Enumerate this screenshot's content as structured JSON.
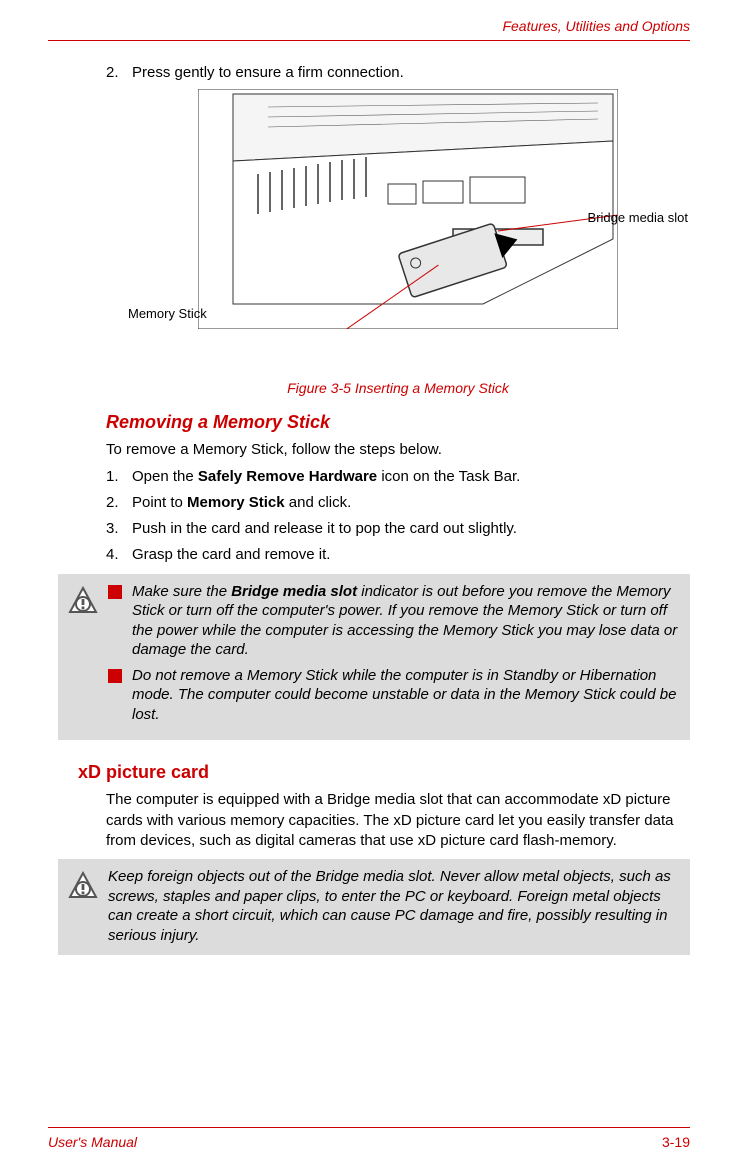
{
  "header": {
    "section_title": "Features, Utilities and Options"
  },
  "step2": {
    "num": "2.",
    "text": "Press gently to ensure a firm connection."
  },
  "figure": {
    "callout_bridge": "Bridge media slot",
    "callout_mem": "Memory Stick",
    "caption": "Figure 3-5 Inserting a Memory Stick"
  },
  "removing": {
    "title": "Removing a Memory Stick",
    "intro": "To remove a Memory Stick, follow the steps below.",
    "steps": [
      {
        "num": "1.",
        "pre": "Open the ",
        "bold": "Safely Remove Hardware",
        "post": " icon on the Task Bar."
      },
      {
        "num": "2.",
        "pre": "Point to ",
        "bold": "Memory Stick",
        "post": " and click."
      },
      {
        "num": "3.",
        "pre": "Push in the card and release it to pop the card out slightly.",
        "bold": "",
        "post": ""
      },
      {
        "num": "4.",
        "pre": "Grasp the card and remove it.",
        "bold": "",
        "post": ""
      }
    ]
  },
  "warn1": {
    "b1_pre": "Make sure the ",
    "b1_bold": "Bridge media slot",
    "b1_post": " indicator is out before you remove the Memory Stick or turn off the computer's power. If you remove the Memory Stick or turn off the power while the computer is accessing the Memory Stick you may lose data or damage the card.",
    "b2": "Do not remove a Memory Stick while the computer is in Standby or Hibernation mode. The computer could become unstable or data in the Memory Stick could be lost."
  },
  "xd": {
    "title": "xD picture card",
    "para": "The computer is equipped with a Bridge media slot that can accommodate xD picture cards with various memory capacities. The xD picture card let you easily transfer data from devices, such as digital cameras that use xD picture card flash-memory."
  },
  "warn2": {
    "text": "Keep foreign objects out of the Bridge media slot. Never allow metal objects, such as screws, staples and paper clips, to enter the PC or keyboard. Foreign metal objects can create a short circuit, which can cause PC damage and fire, possibly resulting in serious injury."
  },
  "footer": {
    "left": "User's Manual",
    "right": "3-19"
  }
}
